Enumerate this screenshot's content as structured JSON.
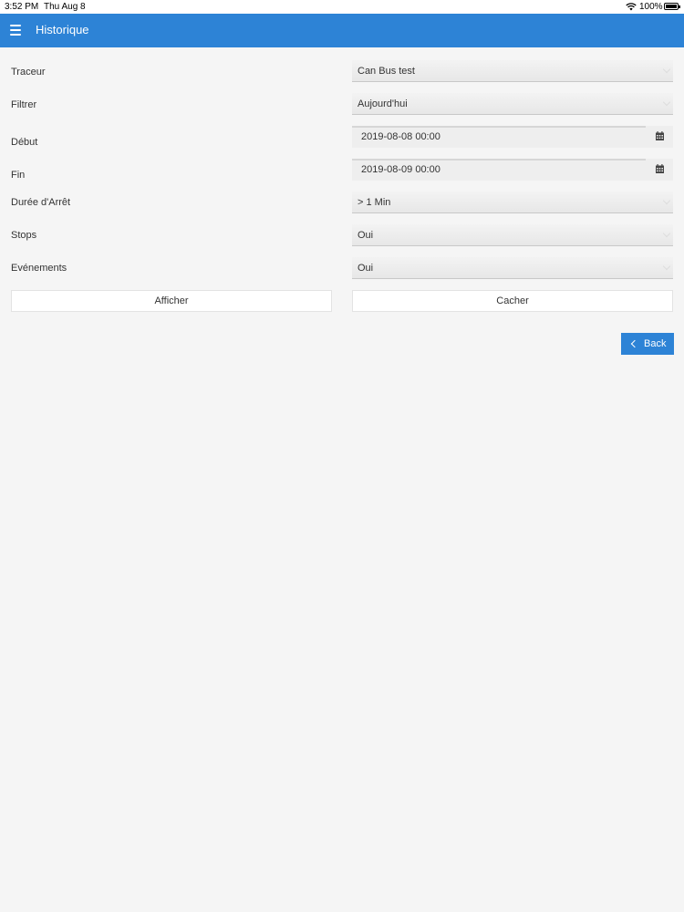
{
  "status_bar": {
    "time": "3:52 PM",
    "date": "Thu Aug 8",
    "battery": "100%"
  },
  "header": {
    "title": "Historique",
    "color": "#2d83d6"
  },
  "form": {
    "tracker": {
      "label": "Traceur",
      "value": "Can Bus test"
    },
    "filter": {
      "label": "Filtrer",
      "value": "Aujourd'hui"
    },
    "start": {
      "label": "Début",
      "value": "2019-08-08 00:00"
    },
    "end": {
      "label": "Fin",
      "value": "2019-08-09 00:00"
    },
    "stop_duration": {
      "label": "Durée d'Arrêt",
      "value": "> 1 Min"
    },
    "stops": {
      "label": "Stops",
      "value": "Oui"
    },
    "events": {
      "label": "Evénements",
      "value": "Oui"
    }
  },
  "buttons": {
    "show": "Afficher",
    "hide": "Cacher",
    "back": "Back"
  }
}
